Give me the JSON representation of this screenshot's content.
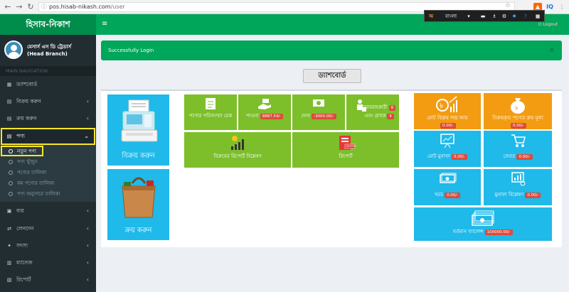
{
  "browser": {
    "url_host": "pos.hisab-nikash.com",
    "url_path": "/user",
    "ext_iq": "IQ"
  },
  "lang_toolbar": {
    "selected": "বাংলা"
  },
  "sidebar": {
    "logo": "হিসাব-নিকাশ",
    "user_name": "মেসার্স এস ডি ট্রেডার্স",
    "user_branch": "(Head Branch)",
    "nav_header": "MAIN NAVIGATION",
    "items": [
      {
        "label": "ড্যাশবোর্ড",
        "icon": "dashboard-icon"
      },
      {
        "label": "বিক্রয় করুন",
        "icon": "cart-icon"
      },
      {
        "label": "ক্রয় করুন",
        "icon": "cart-icon"
      },
      {
        "label": "পণ্য",
        "icon": "cart-icon"
      },
      {
        "label": "ব্যয়",
        "icon": "money-icon"
      },
      {
        "label": "লেনদেন",
        "icon": "exchange-icon"
      },
      {
        "label": "সদস্য",
        "icon": "users-icon"
      },
      {
        "label": "ম্যানেজ",
        "icon": "briefcase-icon"
      },
      {
        "label": "রিপোর্ট",
        "icon": "report-icon"
      }
    ],
    "sub_items": [
      {
        "label": "নতুন পণ্য"
      },
      {
        "label": "পণ্য খুঁজুন"
      },
      {
        "label": "পণ্যের তালিকা"
      },
      {
        "label": "কম পণ্যের তালিকা"
      },
      {
        "label": "পণ্য অনুসারে তালিকা"
      }
    ]
  },
  "header": {
    "menu_glyph": "≡",
    "logout": "Logout"
  },
  "alert": {
    "message": "Successfully Login",
    "close": "×"
  },
  "dashboard": {
    "title": "ড্যাশবোর্ড",
    "sell_tile": "বিক্রয় করুন",
    "buy_tile": "ক্রয় করুন",
    "green_tiles": [
      {
        "label": "পণ্যের পরিসংখ্যা চেক"
      },
      {
        "label": "পাওনা",
        "badge": "8887.54/-"
      },
      {
        "label": "দেনা",
        "badge": "-3000.00/-"
      },
      {
        "label_line1": "সরবরাহকারী",
        "badge1": "8",
        "label_line2": "এবং গ্রাহক",
        "badge2": "4"
      },
      {
        "label": "বিক্রয়ের রিপোর্ট বিশ্লেষণ"
      },
      {
        "label": "রিপোর্ট",
        "report_tag": "REPORT"
      }
    ],
    "stat_tiles": [
      {
        "label": "মোট বিক্রয় লব্ধ আয়",
        "badge": "0.00/-"
      },
      {
        "label": "বিক্রয়কৃত পণ্যের ক্রয় মূল্য",
        "badge": "0.00/-"
      },
      {
        "label": "মোট মুনাফা",
        "badge": "0.00/-"
      },
      {
        "label": "ফেরত",
        "badge": "0.00/-"
      },
      {
        "label": "খরচ",
        "badge": "0.00/-"
      },
      {
        "label": "মুনাফা বিশ্লেষণ",
        "badge": "0.00/-"
      },
      {
        "label": "বর্তমান ব্যালেন্স",
        "badge": "100000.00/-"
      }
    ]
  }
}
